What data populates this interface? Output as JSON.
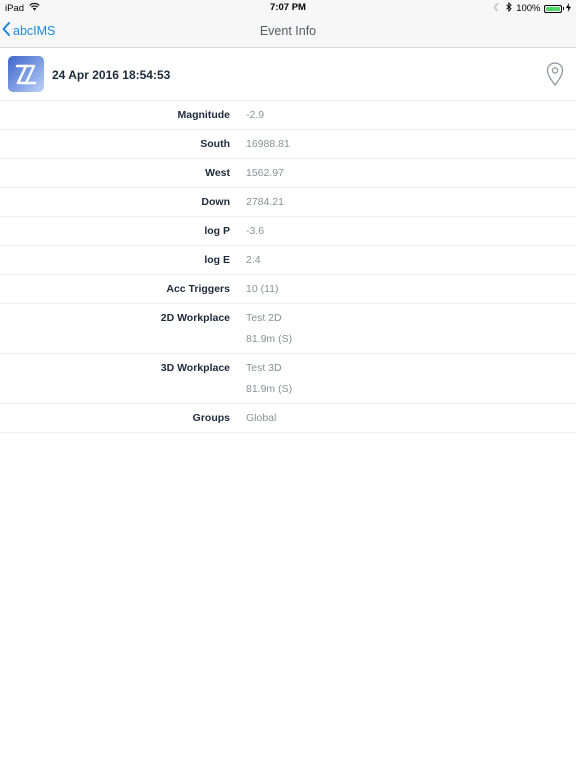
{
  "status_bar": {
    "device": "iPad",
    "time": "7:07 PM",
    "battery_percent": "100%",
    "battery_level": 1.0,
    "battery_color": "#4cd964"
  },
  "nav_bar": {
    "back_label": "abcIMS",
    "title": "Event Info",
    "accent_color": "#1e88d8"
  },
  "event": {
    "timestamp": "24 Apr 2016 18:54:53",
    "logo_icon": "zz-logo-icon",
    "location_icon": "map-pin-icon"
  },
  "details": [
    {
      "label": "Magnitude",
      "values": [
        "-2.9"
      ]
    },
    {
      "label": "South",
      "values": [
        "16988.81"
      ]
    },
    {
      "label": "West",
      "values": [
        "1562.97"
      ]
    },
    {
      "label": "Down",
      "values": [
        "2784.21"
      ]
    },
    {
      "label": "log P",
      "values": [
        "-3.6"
      ]
    },
    {
      "label": "log E",
      "values": [
        "2.4"
      ]
    },
    {
      "label": "Acc Triggers",
      "values": [
        "10 (11)"
      ]
    },
    {
      "label": "2D Workplace",
      "values": [
        "Test 2D",
        "81.9m (S)"
      ]
    },
    {
      "label": "3D Workplace",
      "values": [
        "Test 3D",
        "81.9m (S)"
      ]
    },
    {
      "label": "Groups",
      "values": [
        "Global"
      ]
    }
  ]
}
